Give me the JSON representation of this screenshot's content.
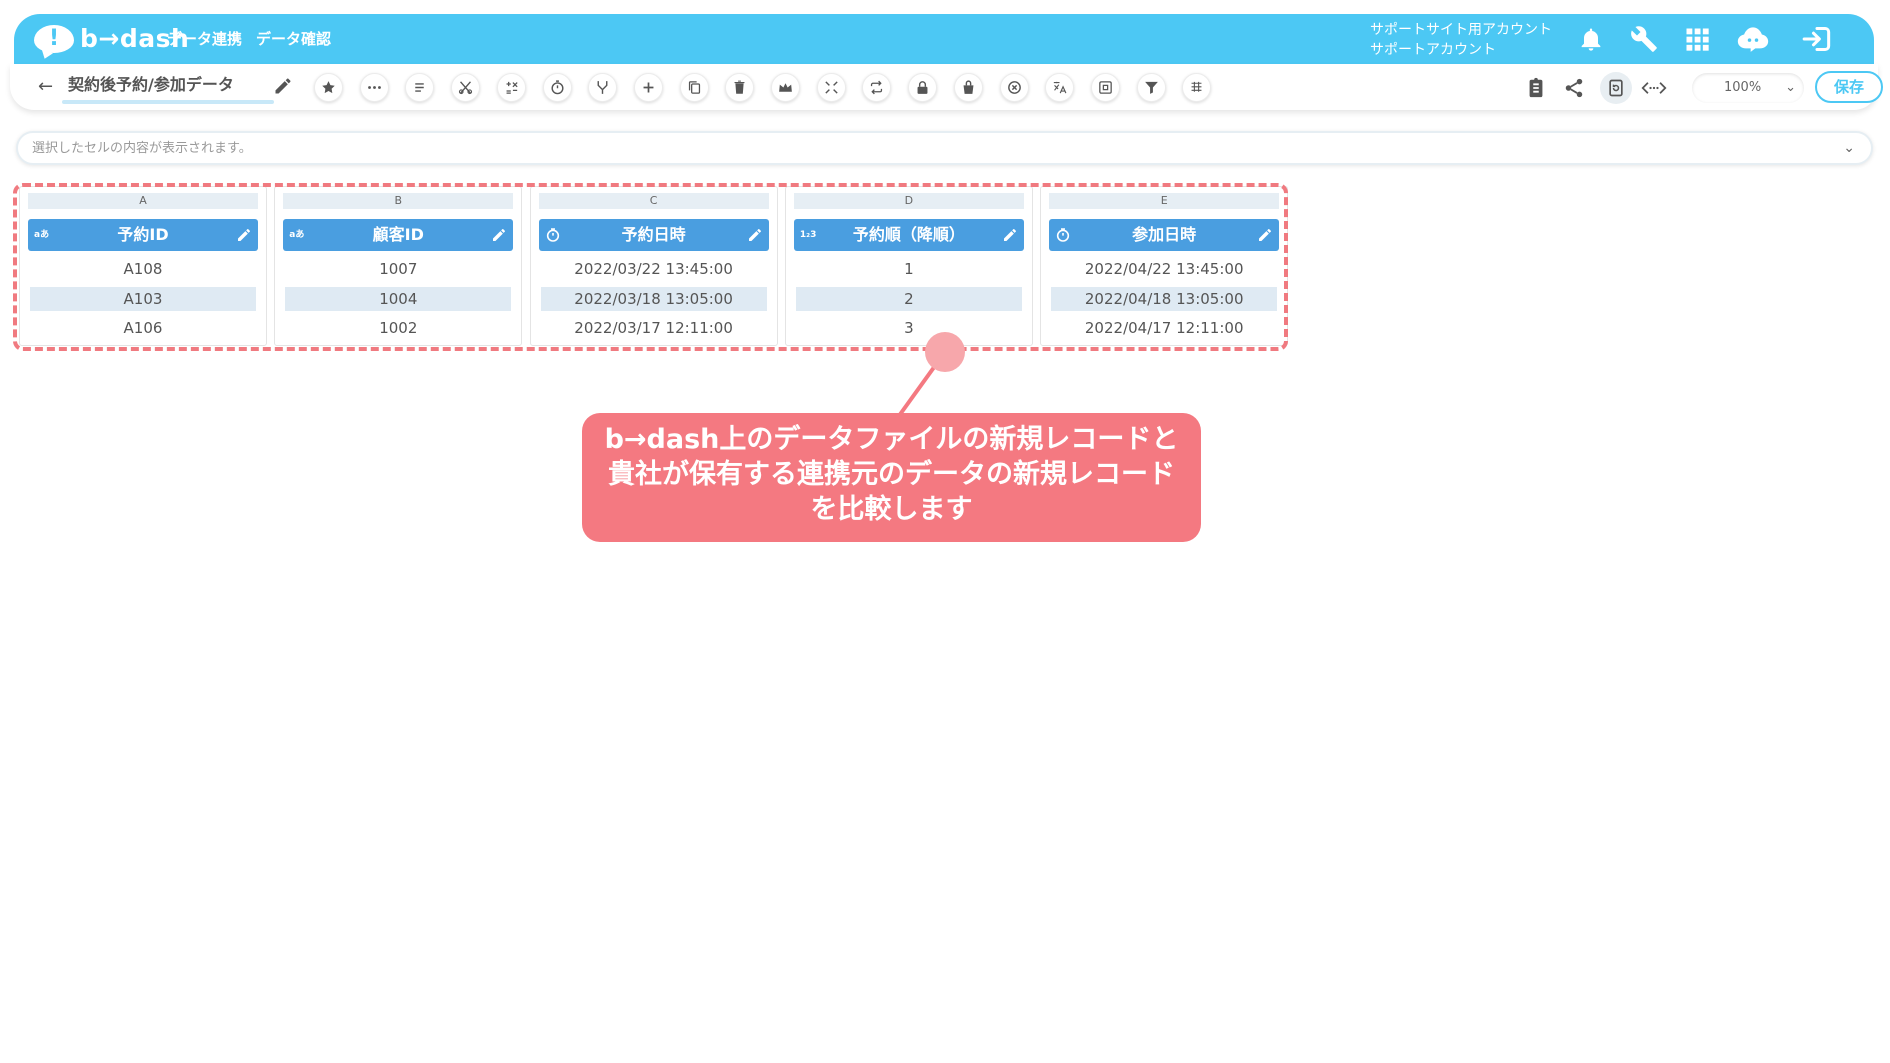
{
  "header": {
    "logo_mark": "!",
    "logo_text": "b→dash",
    "nav": [
      "データ連携",
      "データ確認"
    ],
    "account_line1": "サポートサイト用アカウント",
    "account_line2": "サポートアカウント",
    "icons": [
      "bell-icon",
      "wrench-icon",
      "apps-grid-icon",
      "chat-cloud-icon",
      "logout-icon"
    ]
  },
  "toolbar": {
    "back_icon": "←",
    "file_title": "契約後予約/参加データ",
    "tools": [
      "star-icon",
      "more-icon",
      "list-icon",
      "scissors-icon",
      "calc-icon",
      "timer-icon",
      "merge-icon",
      "plus-icon",
      "copy-icon",
      "trash-icon",
      "crown-icon",
      "expand-icon",
      "repeat-icon",
      "lock-icon",
      "bag-icon",
      "close-circle-icon",
      "translate-icon",
      "frame-icon",
      "filter-icon",
      "grid-icon"
    ],
    "right_icons": [
      "clipboard-icon",
      "share-icon",
      "history-icon",
      "code-icon"
    ],
    "zoom_value": "100%",
    "zoom_chevron": "⌄",
    "save_label": "保存"
  },
  "cellbar": {
    "placeholder": "選択したセルの内容が表示されます。",
    "chevron": "⌄"
  },
  "grid": {
    "columns": [
      {
        "letter": "A",
        "type_label": "aあ",
        "name": "予約ID",
        "values": [
          "A108",
          "A103",
          "A106"
        ]
      },
      {
        "letter": "B",
        "type_label": "aあ",
        "name": "顧客ID",
        "values": [
          "1007",
          "1004",
          "1002"
        ]
      },
      {
        "letter": "C",
        "type_label": "timer",
        "name": "予約日時",
        "values": [
          "2022/03/22 13:45:00",
          "2022/03/18 13:05:00",
          "2022/03/17 12:11:00"
        ]
      },
      {
        "letter": "D",
        "type_label": "1₂3",
        "name": "予約順（降順）",
        "values": [
          "1",
          "2",
          "3"
        ]
      },
      {
        "letter": "E",
        "type_label": "timer",
        "name": "参加日時",
        "values": [
          "2022/04/22 13:45:00",
          "2022/04/18 13:05:00",
          "2022/04/17 12:11:00"
        ]
      }
    ]
  },
  "callout": {
    "lines": [
      "b→dash上のデータファイルの新規レコードと",
      "貴社が保有する連携元のデータの新規レコード",
      "を比較します"
    ],
    "color": "#f47981"
  },
  "colors": {
    "header": "#4cc8f4",
    "column_header": "#4a9ee0",
    "highlight": "#f07a80"
  }
}
